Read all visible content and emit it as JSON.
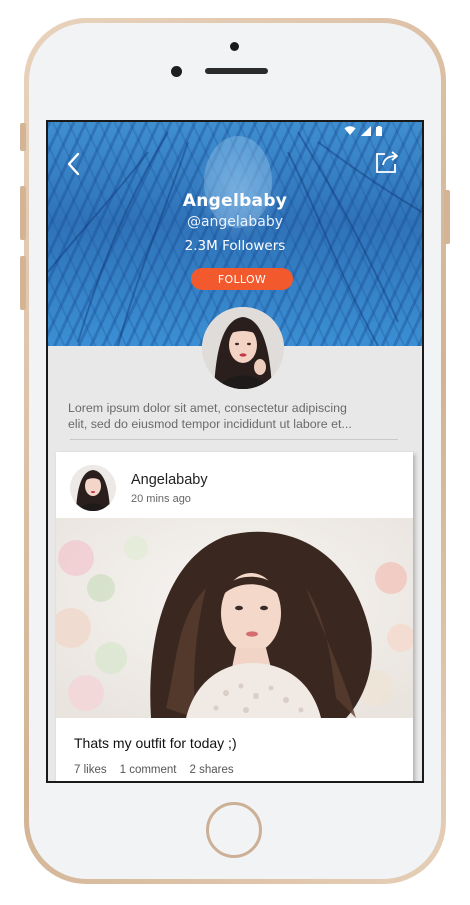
{
  "status_bar": {
    "icons": [
      "wifi-icon",
      "cellular-icon",
      "battery-icon"
    ]
  },
  "header": {
    "back_icon": "back-chevron-icon",
    "share_icon": "share-icon"
  },
  "profile": {
    "name": "Angelbaby",
    "handle": "@angelababy",
    "followers": "2.3M Followers",
    "follow_label": "FOLLOW",
    "bio_lines": [
      "Lorem ipsum dolor sit amet, consectetur adipiscing",
      "elit, sed do eiusmod tempor incididunt ut labore et..."
    ]
  },
  "post": {
    "author": "Angelababy",
    "time": "20 mins ago",
    "caption": "Thats my outfit for today ;)",
    "likes": "7 likes",
    "comments": "1 comment",
    "shares": "2 shares"
  },
  "colors": {
    "hero_blue": "#3b86c9",
    "follow_orange": "#f25a2e",
    "phone_gold": "#d2b394",
    "screen_bg": "#e8e8e8"
  }
}
